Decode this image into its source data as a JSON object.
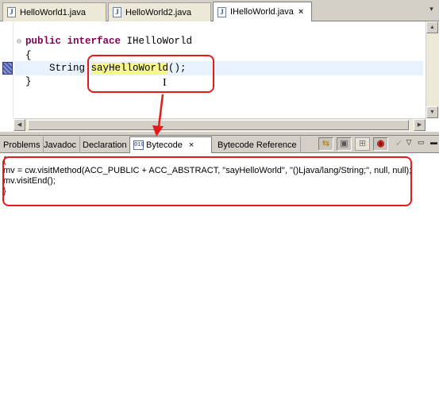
{
  "editor_tabs": [
    {
      "label": "HelloWorld1.java",
      "icon": "java-file-icon"
    },
    {
      "label": "HelloWorld2.java",
      "icon": "java-file-icon"
    },
    {
      "label": "IHelloWorld.java",
      "icon": "java-file-icon",
      "active": true,
      "close": "×"
    }
  ],
  "editor": {
    "lines": [
      {
        "parts": [
          "public",
          " ",
          "interface",
          " IHelloWorld"
        ]
      },
      {
        "text": "{"
      },
      {
        "prefix": "    String ",
        "method": "sayHelloWorld",
        "suffix": "();"
      },
      {
        "text": "}"
      }
    ]
  },
  "view_tabs": [
    {
      "label": "Problems"
    },
    {
      "label": "Javadoc"
    },
    {
      "label": "Declaration"
    },
    {
      "label": "Bytecode",
      "icon": "bytecode-view-icon",
      "active": true,
      "close": "×"
    },
    {
      "label": "Bytecode Reference"
    }
  ],
  "toolbar": {
    "icons": [
      "link-with-editor-icon",
      "show-raw-icon",
      "grid-icon",
      "asm-icon",
      "verify-icon"
    ]
  },
  "bytecode": {
    "lines": [
      "{",
      "mv = cw.visitMethod(ACC_PUBLIC + ACC_ABSTRACT, \"sayHelloWorld\", \"()Ljava/lang/String;\", null, null);",
      "mv.visitEnd();",
      "}"
    ]
  },
  "colors": {
    "keyword": "#7f0055",
    "highlight": "#f6f68a",
    "current_line": "#e8f2fe",
    "annotation": "#e41b1b",
    "chrome": "#d4d0c8"
  }
}
